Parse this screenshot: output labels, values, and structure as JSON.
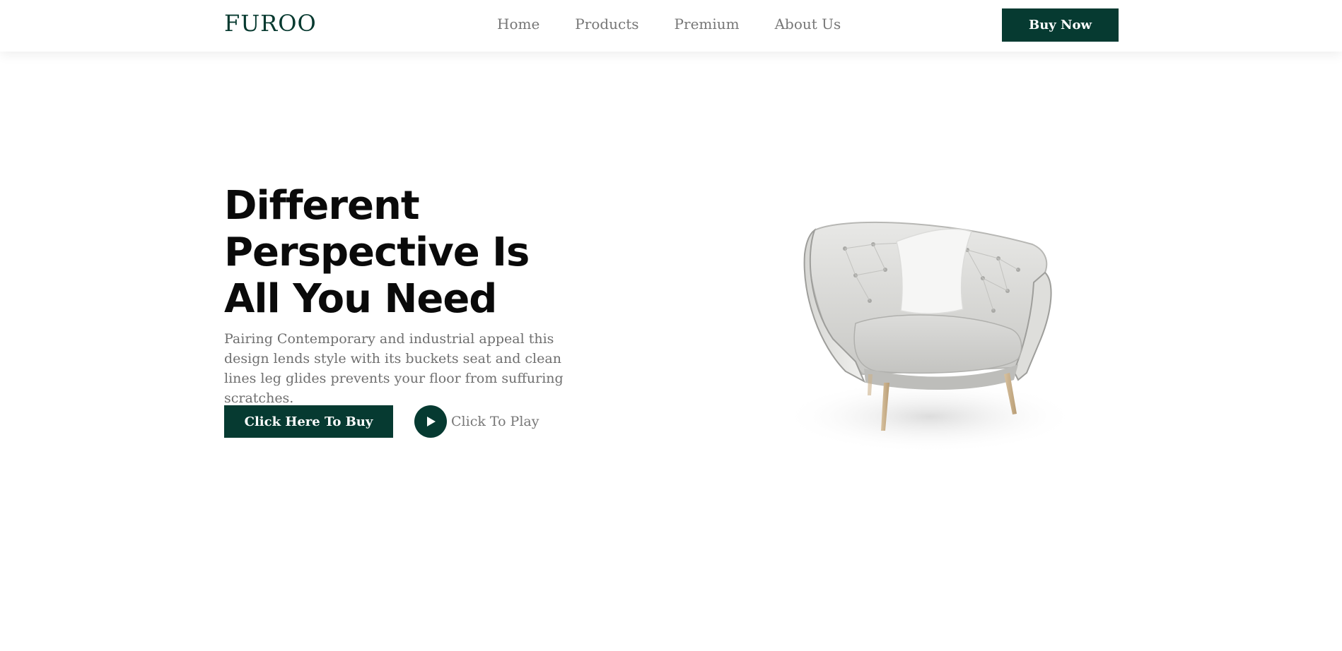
{
  "header": {
    "brand": "FUROO",
    "nav": [
      "Home",
      "Products",
      "Premium",
      "About Us"
    ],
    "buy_now_label": "Buy Now"
  },
  "hero": {
    "title": "Different Perspective Is All You Need",
    "description": "Pairing Contemporary and industrial appeal this design lends style with its buckets seat and clean lines leg glides prevents your floor from suffuring scratches.",
    "cta_label": "Click Here To Buy",
    "play_label": "Click To Play"
  },
  "colors": {
    "accent": "#063a31",
    "nav_text": "#777777",
    "body_text": "#6f6f6f"
  },
  "icons": {
    "play": "play-icon"
  }
}
